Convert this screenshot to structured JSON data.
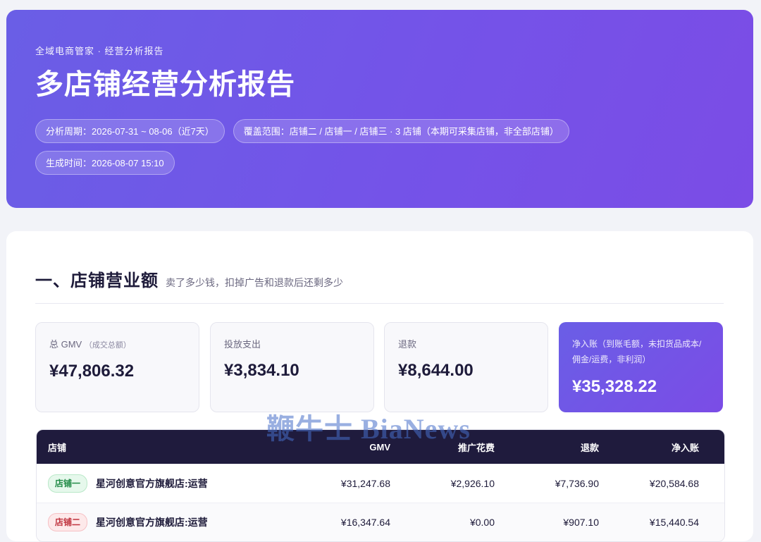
{
  "hero": {
    "eyebrow": "全域电商管家 · 经营分析报告",
    "title": "多店铺经营分析报告",
    "period": "分析周期：2026-07-31 ~ 08-06（近7天）",
    "scope": "覆盖范围：店铺二 / 店铺一 / 店铺三 · 3 店铺（本期可采集店铺，非全部店铺）",
    "generated": "生成时间：2026-08-07 15:10"
  },
  "section": {
    "title": "一、店铺营业额",
    "subtitle": "卖了多少钱，扣掉广告和退款后还剩多少"
  },
  "kpis": [
    {
      "label": "总 GMV",
      "note": "（成交总额）",
      "value": "¥47,806.32"
    },
    {
      "label": "投放支出",
      "note": "",
      "value": "¥3,834.10"
    },
    {
      "label": "退款",
      "note": "",
      "value": "¥8,644.00"
    },
    {
      "label": "净入账（到账毛额，未扣货品成本/佣金/运费，非利润）",
      "note": "",
      "value": "¥35,328.22"
    }
  ],
  "table": {
    "headers": [
      "店铺",
      "GMV",
      "推广花费",
      "退款",
      "净入账"
    ],
    "rows": [
      {
        "tag": "店铺一",
        "name": "星河创意官方旗舰店:运营",
        "gmv": "¥31,247.68",
        "ad": "¥2,926.10",
        "refund": "¥7,736.90",
        "net": "¥20,584.68"
      },
      {
        "tag": "店铺二",
        "name": "星河创意官方旗舰店:运营",
        "gmv": "¥16,347.64",
        "ad": "¥0.00",
        "refund": "¥907.10",
        "net": "¥15,440.54"
      }
    ]
  },
  "watermark": "鞭牛士 BiaNews",
  "colors": {
    "accent": "#7453e8",
    "header_dark": "#1f1b3d",
    "tag_green": "#1f8a45",
    "tag_red": "#c0343f"
  }
}
